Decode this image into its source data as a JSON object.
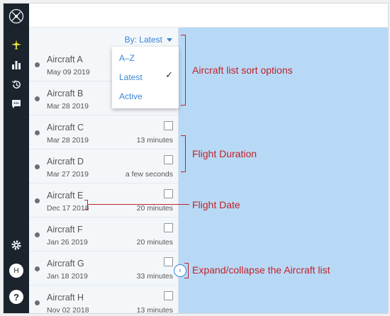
{
  "sidebar": {
    "items": [
      {
        "icon": "aircraft-icon"
      },
      {
        "icon": "bar-chart-icon"
      },
      {
        "icon": "history-icon"
      },
      {
        "icon": "chat-icon"
      },
      {
        "icon": "gear-icon"
      },
      {
        "icon": "avatar",
        "label": "H"
      },
      {
        "icon": "help-icon",
        "label": "?"
      }
    ],
    "colors": {
      "bg": "#1b232c",
      "active": "#e5e83a"
    }
  },
  "aircraft_list": {
    "sort_label": "By: Latest",
    "sort_options": [
      "A–Z",
      "Latest",
      "Active"
    ],
    "selected_sort": "Latest",
    "rows": [
      {
        "name": "Aircraft A",
        "date": "May 09 2019",
        "duration": ""
      },
      {
        "name": "Aircraft B",
        "date": "Mar 28 2019",
        "duration": ""
      },
      {
        "name": "Aircraft C",
        "date": "Mar 28 2019",
        "duration": "13 minutes"
      },
      {
        "name": "Aircraft D",
        "date": "Mar 27 2019",
        "duration": "a few seconds"
      },
      {
        "name": "Aircraft E",
        "date": "Dec 17 2018",
        "duration": "20 minutes"
      },
      {
        "name": "Aircraft F",
        "date": "Jan 26 2019",
        "duration": "20 minutes"
      },
      {
        "name": "Aircraft G",
        "date": "Jan 18 2019",
        "duration": "33 minutes"
      },
      {
        "name": "Aircraft H",
        "date": "Nov 02 2018",
        "duration": "13 minutes"
      }
    ]
  },
  "annotations": {
    "sort_options": "Aircraft list sort options",
    "flight_duration": "Flight Duration",
    "flight_date": "Flight Date",
    "expand_collapse": "Expand/collapse the Aircraft list"
  },
  "colors": {
    "accent": "#3a86d8",
    "annotation": "#c0232a",
    "map": "#b8d9f6"
  }
}
